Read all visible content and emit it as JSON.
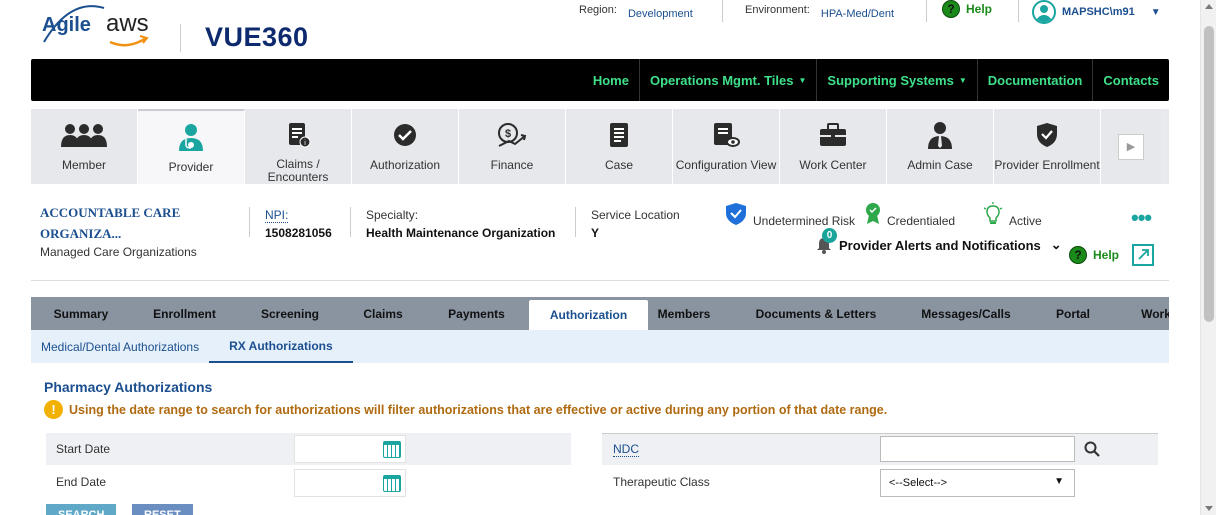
{
  "header": {
    "logo_agile": "Agile",
    "logo_aws": "aws",
    "logo_vue": "VUE360",
    "region_label": "Region:",
    "region_value": "Development",
    "environment_label": "Environment:",
    "environment_value": "HPA-Med/Dent",
    "help_label": "Help",
    "user_name": "MAPSHC\\m91"
  },
  "main_nav": {
    "items": [
      {
        "label": "Home"
      },
      {
        "label": "Operations Mgmt. Tiles"
      },
      {
        "label": "Supporting Systems"
      },
      {
        "label": "Documentation"
      },
      {
        "label": "Contacts"
      }
    ]
  },
  "tiles": [
    {
      "label": "Member",
      "icon": "members-icon"
    },
    {
      "label": "Provider",
      "icon": "provider-icon"
    },
    {
      "label": "Claims / Encounters",
      "icon": "claims-icon"
    },
    {
      "label": "Authorization",
      "icon": "check-circle-icon"
    },
    {
      "label": "Finance",
      "icon": "finance-icon"
    },
    {
      "label": "Case",
      "icon": "case-icon"
    },
    {
      "label": "Configuration View",
      "icon": "config-icon"
    },
    {
      "label": "Work Center",
      "icon": "briefcase-icon"
    },
    {
      "label": "Admin Case",
      "icon": "admin-icon"
    },
    {
      "label": "Provider Enrollment",
      "icon": "shield-check-icon"
    }
  ],
  "provider": {
    "name": "ACCOUNTABLE CARE ORGANIZA...",
    "type": "Managed Care Organizations",
    "npi_label": "NPI:",
    "npi_value": "1508281056",
    "specialty_label": "Specialty:",
    "specialty_value": "Health Maintenance Organization",
    "service_location_label": "Service Location",
    "service_location_value": "Y",
    "risk_label": "Undetermined Risk",
    "credentialed_label": "Credentialed",
    "active_label": "Active",
    "alerts_label": "Provider Alerts and Notifications",
    "alerts_count": "0",
    "help_label": "Help"
  },
  "sub_tabs": [
    {
      "label": "Summary",
      "w": 100
    },
    {
      "label": "Enrollment",
      "w": 107
    },
    {
      "label": "Screening",
      "w": 104
    },
    {
      "label": "Claims",
      "w": 82
    },
    {
      "label": "Payments",
      "w": 105
    },
    {
      "label": "Authorization",
      "w": 119
    },
    {
      "label": "Members",
      "w": 72
    },
    {
      "label": "Documents & Letters",
      "w": 192
    },
    {
      "label": "Messages/Calls",
      "w": 108
    },
    {
      "label": "Portal",
      "w": 106
    },
    {
      "label": "Work",
      "w": 60
    }
  ],
  "auth_tabs": [
    {
      "label": "Medical/Dental Authorizations"
    },
    {
      "label": "RX Authorizations"
    }
  ],
  "pharmacy": {
    "title": "Pharmacy Authorizations",
    "warning": "Using the date range to search for authorizations will filter authorizations that are effective or active during any portion of that date range.",
    "start_date_label": "Start Date",
    "end_date_label": "End Date",
    "ndc_label": "NDC",
    "therapeutic_class_label": "Therapeutic Class",
    "therapeutic_class_value": "<--Select-->",
    "start_date_value": "",
    "end_date_value": "",
    "ndc_value": "",
    "search_button": "SEARCH",
    "reset_button": "RESET"
  }
}
